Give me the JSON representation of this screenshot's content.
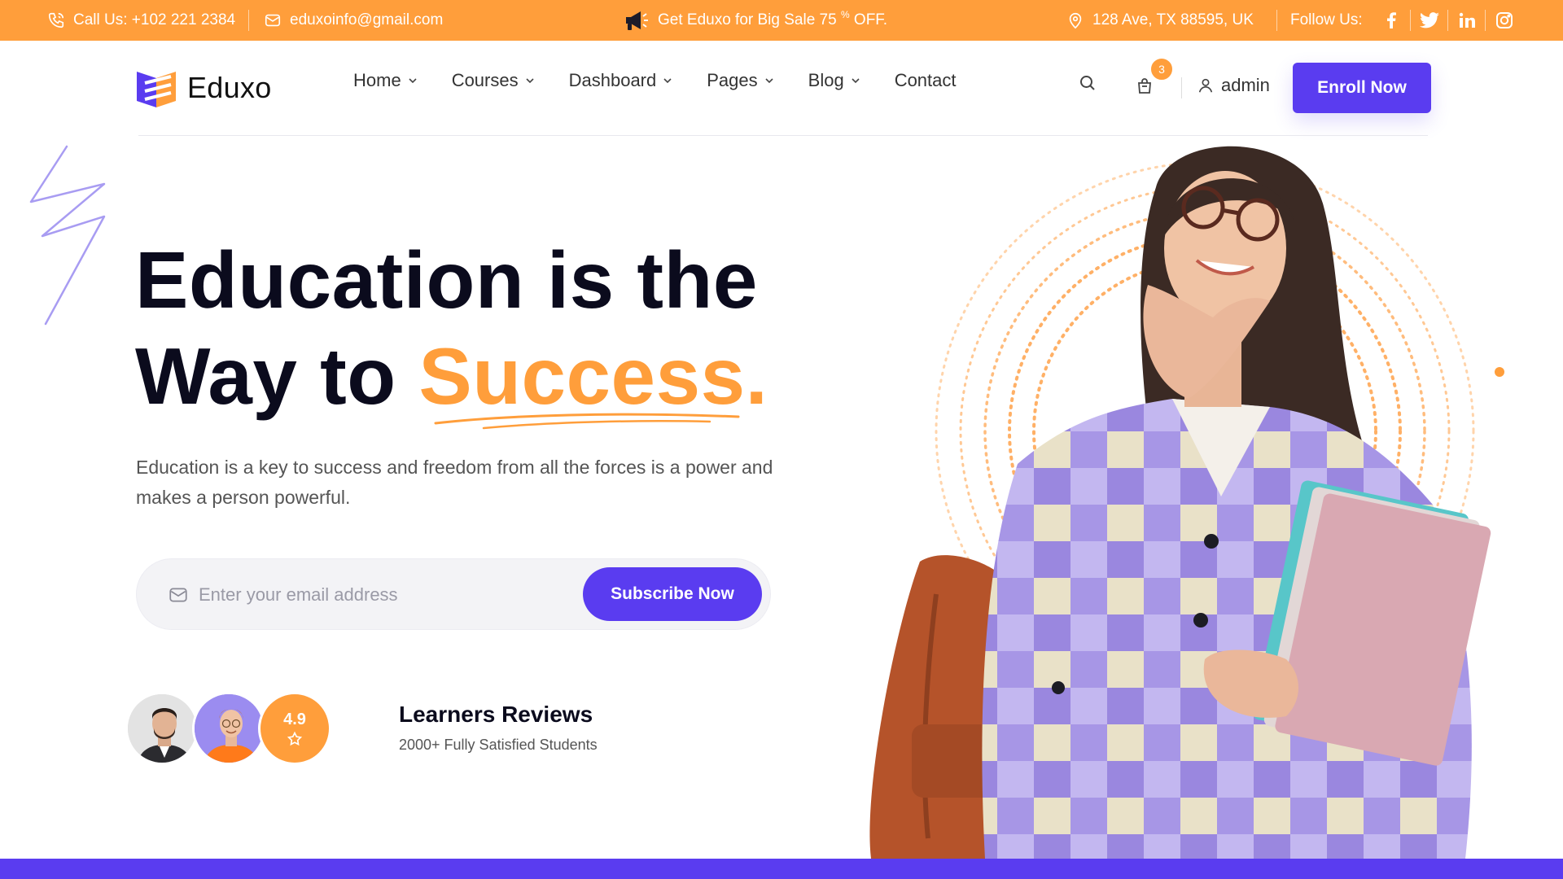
{
  "colors": {
    "accent": "#ff9e3b",
    "brand": "#5a3cf0",
    "text": "#0b0b1d"
  },
  "topbar": {
    "phone": "Call Us: +102 221 2384",
    "email": "eduxoinfo@gmail.com",
    "promo": "Get Eduxo for Big Sale 75",
    "promo_sup": "%",
    "promo_end": "OFF.",
    "address": "128 Ave, TX 88595, UK",
    "follow": "Follow Us:",
    "social": [
      "facebook-icon",
      "twitter-icon",
      "linkedin-icon",
      "instagram-icon"
    ]
  },
  "header": {
    "logo": "Eduxo",
    "nav": [
      "Home",
      "Courses",
      "Dashboard",
      "Pages",
      "Blog",
      "Contact"
    ],
    "cart_count": "3",
    "user": "admin",
    "cta": "Enroll Now"
  },
  "hero": {
    "title_line1": "Education is the",
    "title_line2_start": "Way to",
    "title_accent": "Success.",
    "description": "Education is a key to success and freedom from all the forces is a power and makes a person powerful.",
    "email_placeholder": "Enter your email address",
    "subscribe": "Subscribe Now"
  },
  "reviews": {
    "rating": "4.9",
    "title": "Learners Reviews",
    "subtitle": "2000+ Fully Satisfied Students"
  }
}
